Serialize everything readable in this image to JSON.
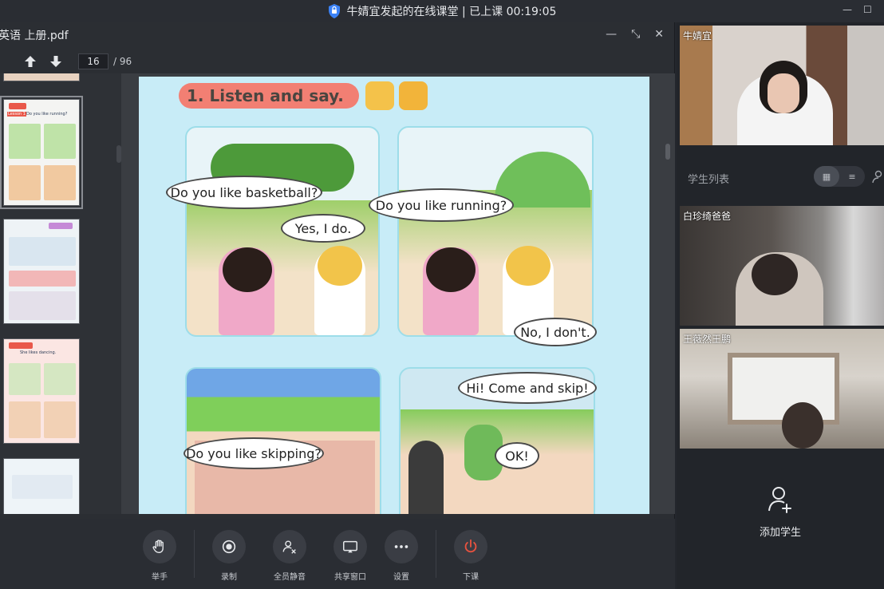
{
  "window": {
    "title": "牛婧宜发起的在线课堂 | 已上课 00:19:05",
    "controls": [
      "minimize",
      "maximize"
    ]
  },
  "pdf": {
    "filename": "英语 上册.pdf",
    "current_page": "16",
    "total_pages": "/ 96",
    "page": {
      "heading": "1. Listen and say.",
      "speech": {
        "p1_a": "Do you like basketball?",
        "p1_b": "Yes, I do.",
        "p2_a": "Do you like running?",
        "p2_b": "No, I don't.",
        "p3_a": "Do you like skipping?",
        "p4_a": "Hi! Come and skip!",
        "p4_b": "OK!"
      }
    },
    "thumbnails": {
      "t2_lesson": "Lesson 1",
      "t2_title": "Do you like running?",
      "t4_title": "She likes dancing."
    }
  },
  "toolbar": {
    "raise_hand": "举手",
    "record": "录制",
    "mute_all": "全员静音",
    "share_window": "共享窗口",
    "settings": "设置",
    "end_class": "下课"
  },
  "participants": {
    "teacher_name": "牛婧宜",
    "student_list_label": "学生列表",
    "students": [
      {
        "name": "白珍绮爸爸"
      },
      {
        "name": "王薇然王鹏"
      }
    ],
    "add_student_label": "添加学生"
  },
  "colors": {
    "accent_red": "#e8523f",
    "page_bg": "#c8ecf7",
    "title_pill": "#f27f73"
  }
}
